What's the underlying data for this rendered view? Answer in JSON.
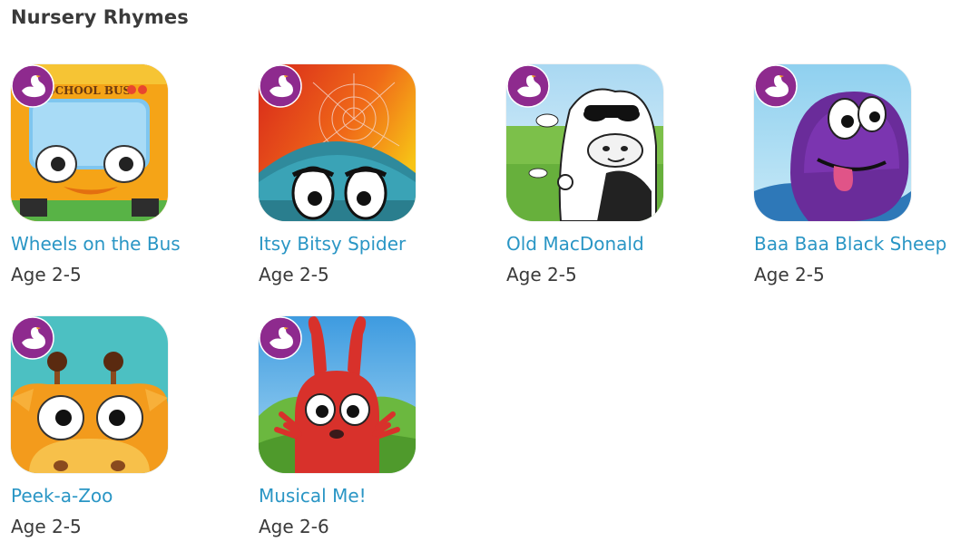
{
  "section": {
    "title": "Nursery Rhymes"
  },
  "badge": {
    "icon": "swan-icon",
    "color": "#8e2a8e"
  },
  "colors": {
    "link": "#2a96c5",
    "text": "#3a3a3a"
  },
  "apps": [
    {
      "title": "Wheels on the Bus",
      "age": "Age 2-5",
      "icon": "school-bus-icon",
      "icon_text": "SCHOOL BUS"
    },
    {
      "title": "Itsy Bitsy Spider",
      "age": "Age 2-5",
      "icon": "spider-icon"
    },
    {
      "title": "Old MacDonald",
      "age": "Age 2-5",
      "icon": "cow-icon"
    },
    {
      "title": "Baa Baa Black Sheep",
      "age": "Age 2-5",
      "icon": "purple-sheep-icon"
    },
    {
      "title": "Peek-a-Zoo",
      "age": "Age 2-5",
      "icon": "giraffe-icon"
    },
    {
      "title": "Musical Me!",
      "age": "Age 2-6",
      "icon": "red-bunny-icon"
    }
  ]
}
